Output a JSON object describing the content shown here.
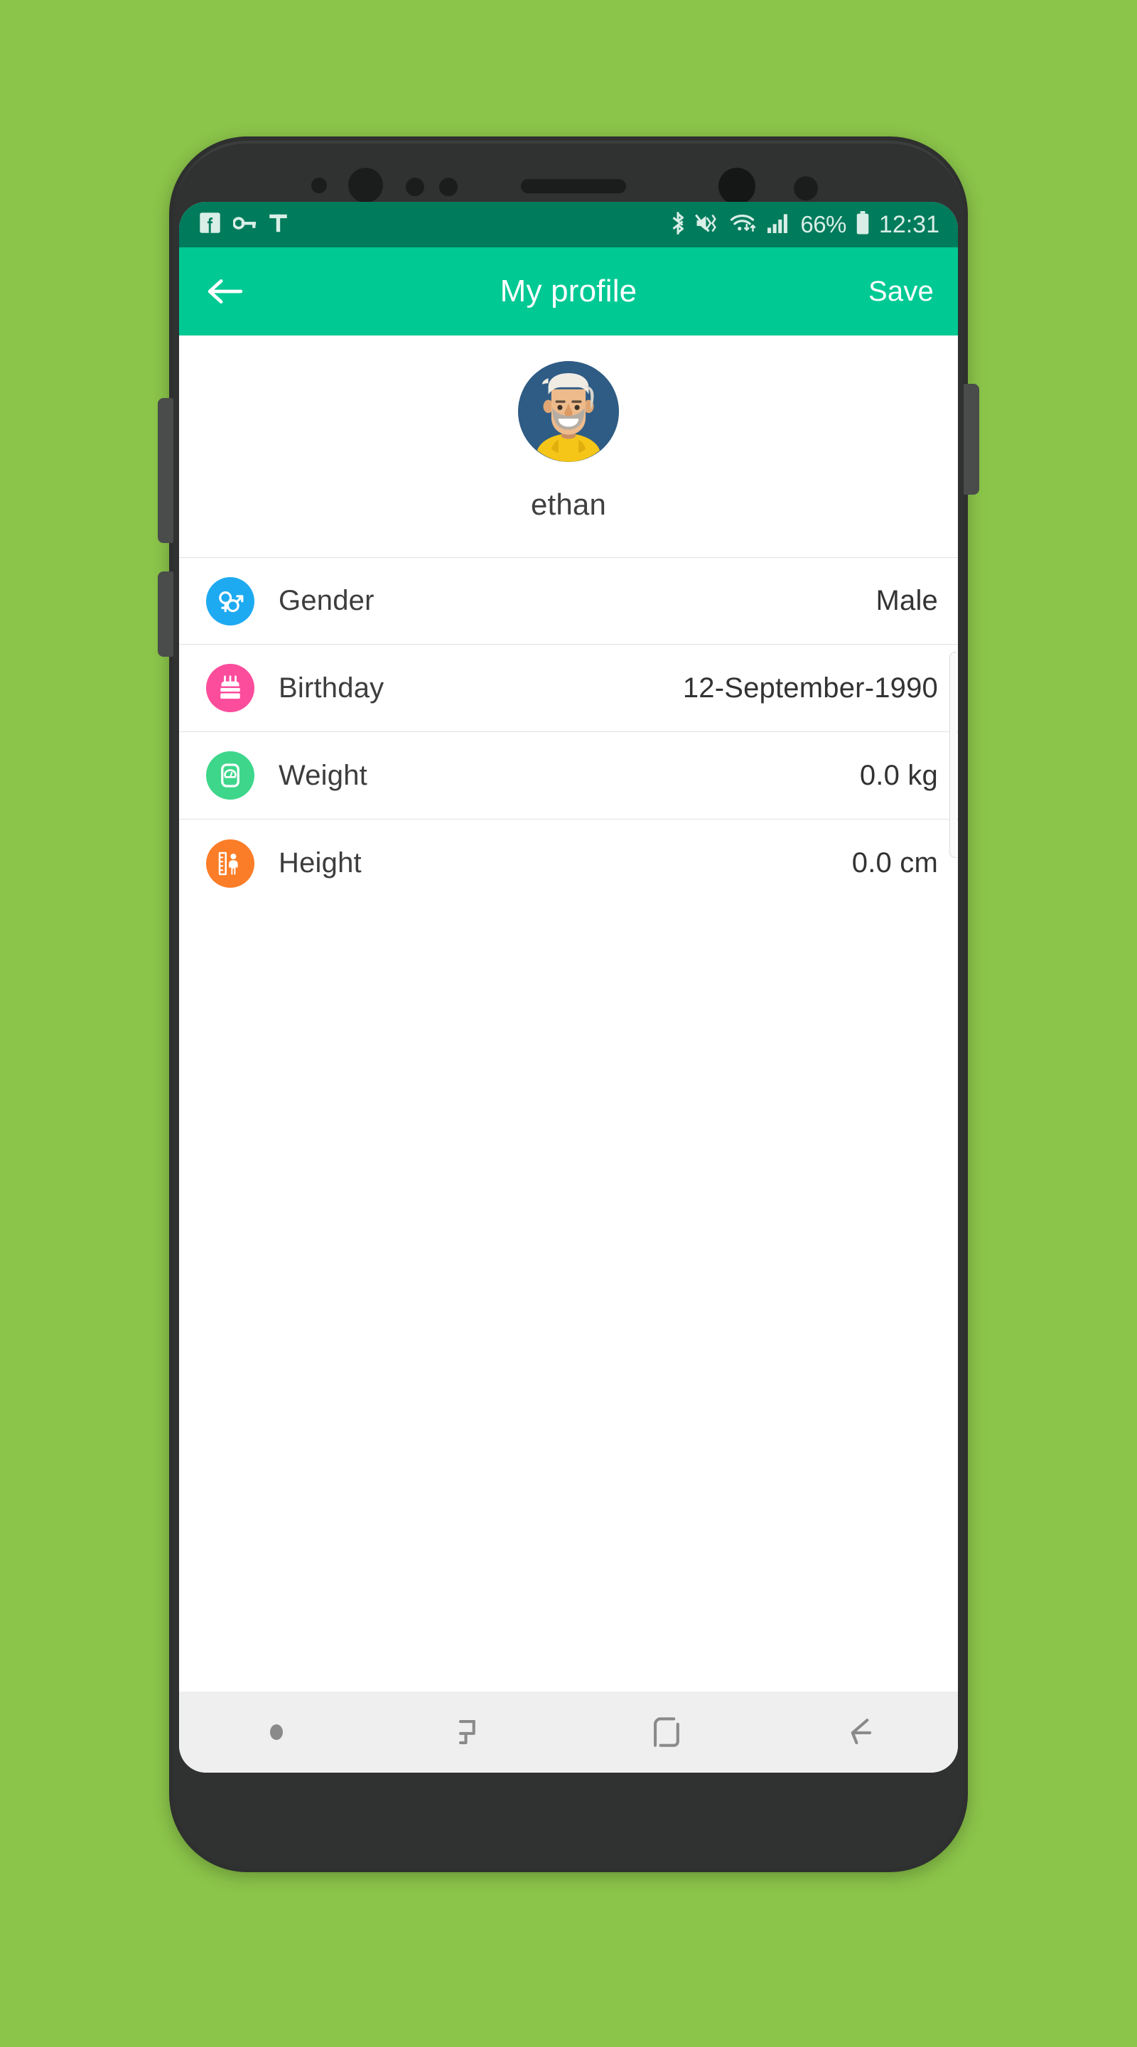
{
  "device": {
    "hardware": {
      "proximity_sensor": "proximity-sensor",
      "iris_scanner": "iris-scanner",
      "light_sensor": "light-sensor",
      "led_indicator": "led-indicator",
      "earpiece": "earpiece-speaker",
      "front_camera": "front-camera",
      "secondary_sensor": "secondary-sensor",
      "volume_up": "volume-up-button",
      "volume_down": "volume-down-button",
      "power": "power-button"
    }
  },
  "statusbar": {
    "left_icons": [
      {
        "name": "facebook-icon",
        "label": "Facebook"
      },
      {
        "name": "vpn-key-icon",
        "label": "VPN key"
      },
      {
        "name": "text-input-icon",
        "label": "Keyboard T"
      }
    ],
    "right_icons": [
      {
        "name": "bluetooth-icon",
        "label": "Bluetooth"
      },
      {
        "name": "mute-vibrate-icon",
        "label": "Sound muted"
      },
      {
        "name": "wifi-icon",
        "label": "Wi-Fi with data transfer"
      },
      {
        "name": "cellular-signal-icon",
        "label": "Cellular signal"
      }
    ],
    "battery_percent": "66%",
    "battery_icon": "battery-icon",
    "time": "12:31"
  },
  "appbar": {
    "back_icon": "back-arrow-icon",
    "title": "My profile",
    "save_label": "Save",
    "background_color": "#00c994"
  },
  "profile": {
    "avatar_name": "user-avatar",
    "avatar_bg_color": "#2f5c85",
    "username": "ethan"
  },
  "fields": [
    {
      "key": "gender",
      "label": "Gender",
      "value": "Male",
      "icon_name": "gender-icon",
      "icon_color": "#1eaaf1"
    },
    {
      "key": "birthday",
      "label": "Birthday",
      "value": "12-September-1990",
      "icon_name": "birthday-cake-icon",
      "icon_color": "#fc4d9c"
    },
    {
      "key": "weight",
      "label": "Weight",
      "value": "0.0 kg",
      "icon_name": "weight-scale-icon",
      "icon_color": "#3ed68b"
    },
    {
      "key": "height",
      "label": "Height",
      "value": "0.0 cm",
      "icon_name": "height-ruler-icon",
      "icon_color": "#fb7d28"
    }
  ],
  "scrollbar": {
    "name": "vertical-scrollbar"
  },
  "navbar": {
    "items": [
      {
        "name": "nav-dot-indicator",
        "label": "Indicator dot"
      },
      {
        "name": "recents-button",
        "label": "Recent apps"
      },
      {
        "name": "home-button",
        "label": "Home"
      },
      {
        "name": "back-button",
        "label": "Back"
      }
    ]
  },
  "theme": {
    "page_background": "#8bc54a",
    "statusbar_color": "#007b5c",
    "accent_color": "#00c994"
  }
}
